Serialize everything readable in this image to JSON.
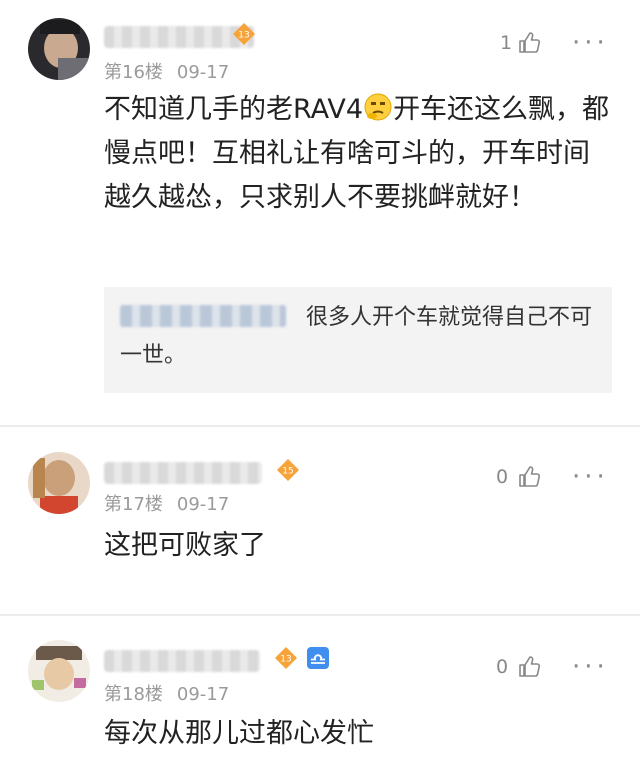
{
  "comments": [
    {
      "level": "13",
      "floor": "第16楼",
      "date": "09-17",
      "likes": "1",
      "more": "···",
      "text_before_emoji": "不知道几手的老RAV4",
      "text_after_emoji": "开车还这么飘，都慢点吧！互相礼让有啥可斗的，开车时间越久越怂，只求别人不要挑衅就好！",
      "reply_text": "很多人开个车就觉得自己不可一世。"
    },
    {
      "level": "15",
      "floor": "第17楼",
      "date": "09-17",
      "likes": "0",
      "more": "···",
      "text": "这把可败家了"
    },
    {
      "level": "13",
      "floor": "第18楼",
      "date": "09-17",
      "likes": "0",
      "more": "···",
      "text": "每次从那儿过都心发忙"
    }
  ],
  "colors": {
    "badge": "#f6a33a",
    "zodiac": "#3f8ef0",
    "quote_bg": "#f3f3f3"
  },
  "icons": [
    "avatar",
    "level-badge-icon",
    "libra-zodiac-icon",
    "thumbs-up-icon",
    "thinking-emoji-icon",
    "more-icon"
  ]
}
